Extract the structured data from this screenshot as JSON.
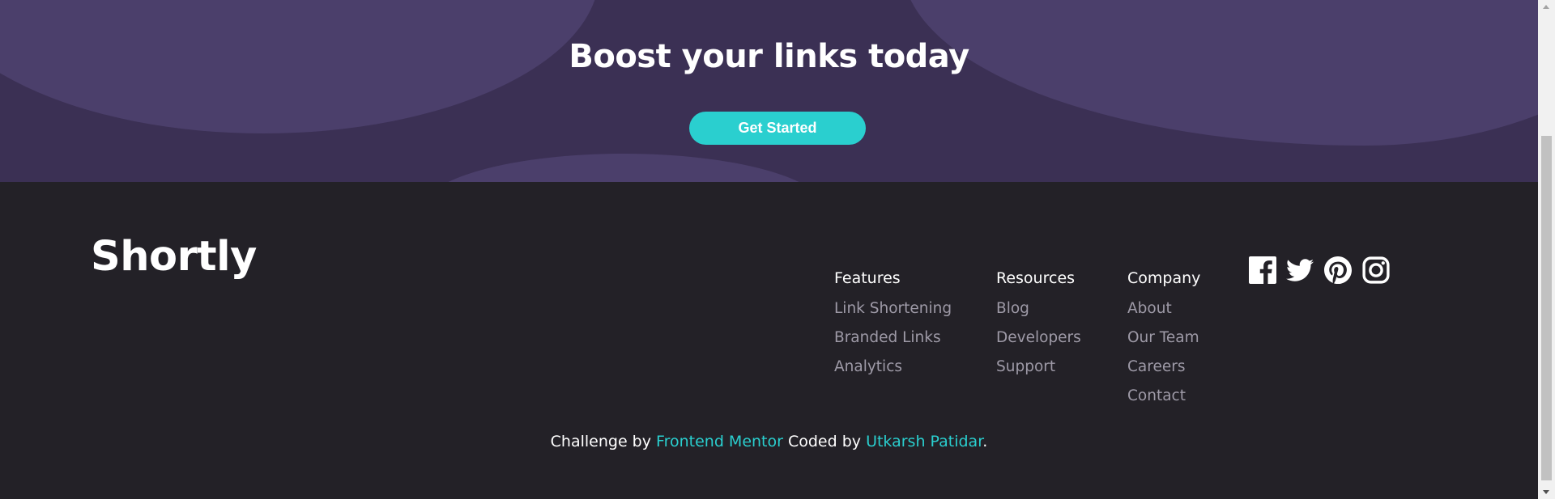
{
  "boost": {
    "title": "Boost your links today",
    "cta_label": "Get Started"
  },
  "footer": {
    "logo": "Shortly",
    "columns": [
      {
        "heading": "Features",
        "links": [
          "Link Shortening",
          "Branded Links",
          "Analytics"
        ]
      },
      {
        "heading": "Resources",
        "links": [
          "Blog",
          "Developers",
          "Support"
        ]
      },
      {
        "heading": "Company",
        "links": [
          "About",
          "Our Team",
          "Careers",
          "Contact"
        ]
      }
    ],
    "social": [
      "facebook-icon",
      "twitter-icon",
      "pinterest-icon",
      "instagram-icon"
    ],
    "attribution": {
      "prefix": "Challenge by ",
      "link1": "Frontend Mentor",
      "middle": " Coded by ",
      "link2": "Utkarsh Patidar",
      "suffix": "."
    }
  },
  "colors": {
    "accent": "#2acfcf",
    "dark_violet": "#3b3054",
    "footer_bg": "#232127",
    "link_gray": "#9e9aa7"
  }
}
